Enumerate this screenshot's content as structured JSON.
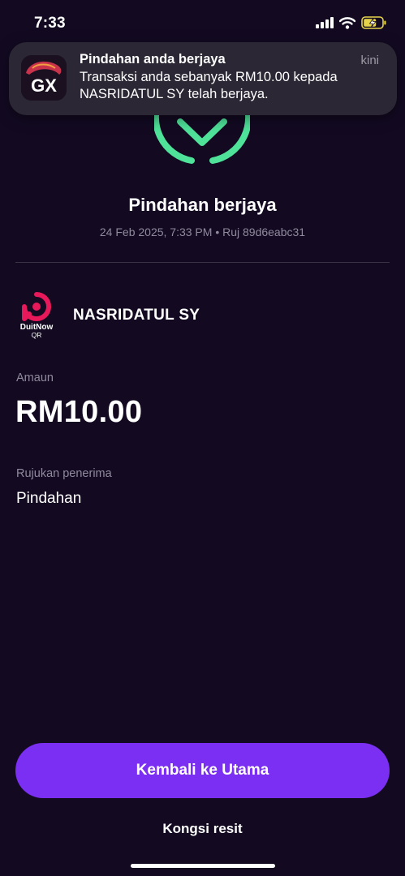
{
  "status_bar": {
    "time": "7:33",
    "icons": [
      "signal-icon",
      "wifi-icon",
      "battery-charging-icon"
    ]
  },
  "notification": {
    "app_icon": "gx-app-icon",
    "app_icon_text": "GX",
    "title": "Pindahan anda berjaya",
    "time": "kini",
    "body": "Transaksi anda sebanyak RM10.00 kepada NASRIDATUL SY telah berjaya."
  },
  "result": {
    "icon": "success-check-icon",
    "title": "Pindahan berjaya",
    "meta": "24 Feb 2025, 7:33 PM • Ruj 89d6eabc31"
  },
  "recipient": {
    "logo": "duitnow-qr-logo",
    "logo_text_1": "DuitNow",
    "logo_text_2": "QR",
    "name": "NASRIDATUL SY"
  },
  "amount": {
    "label": "Amaun",
    "value": "RM10.00"
  },
  "reference": {
    "label": "Rujukan penerima",
    "value": "Pindahan"
  },
  "actions": {
    "primary_label": "Kembali ke Utama",
    "share_label": "Kongsi resit"
  },
  "colors": {
    "background": "#130a22",
    "accent": "#7b2ff2",
    "success": "#4fe39a",
    "duitnow": "#e8195a",
    "banner": "#2b2734"
  }
}
